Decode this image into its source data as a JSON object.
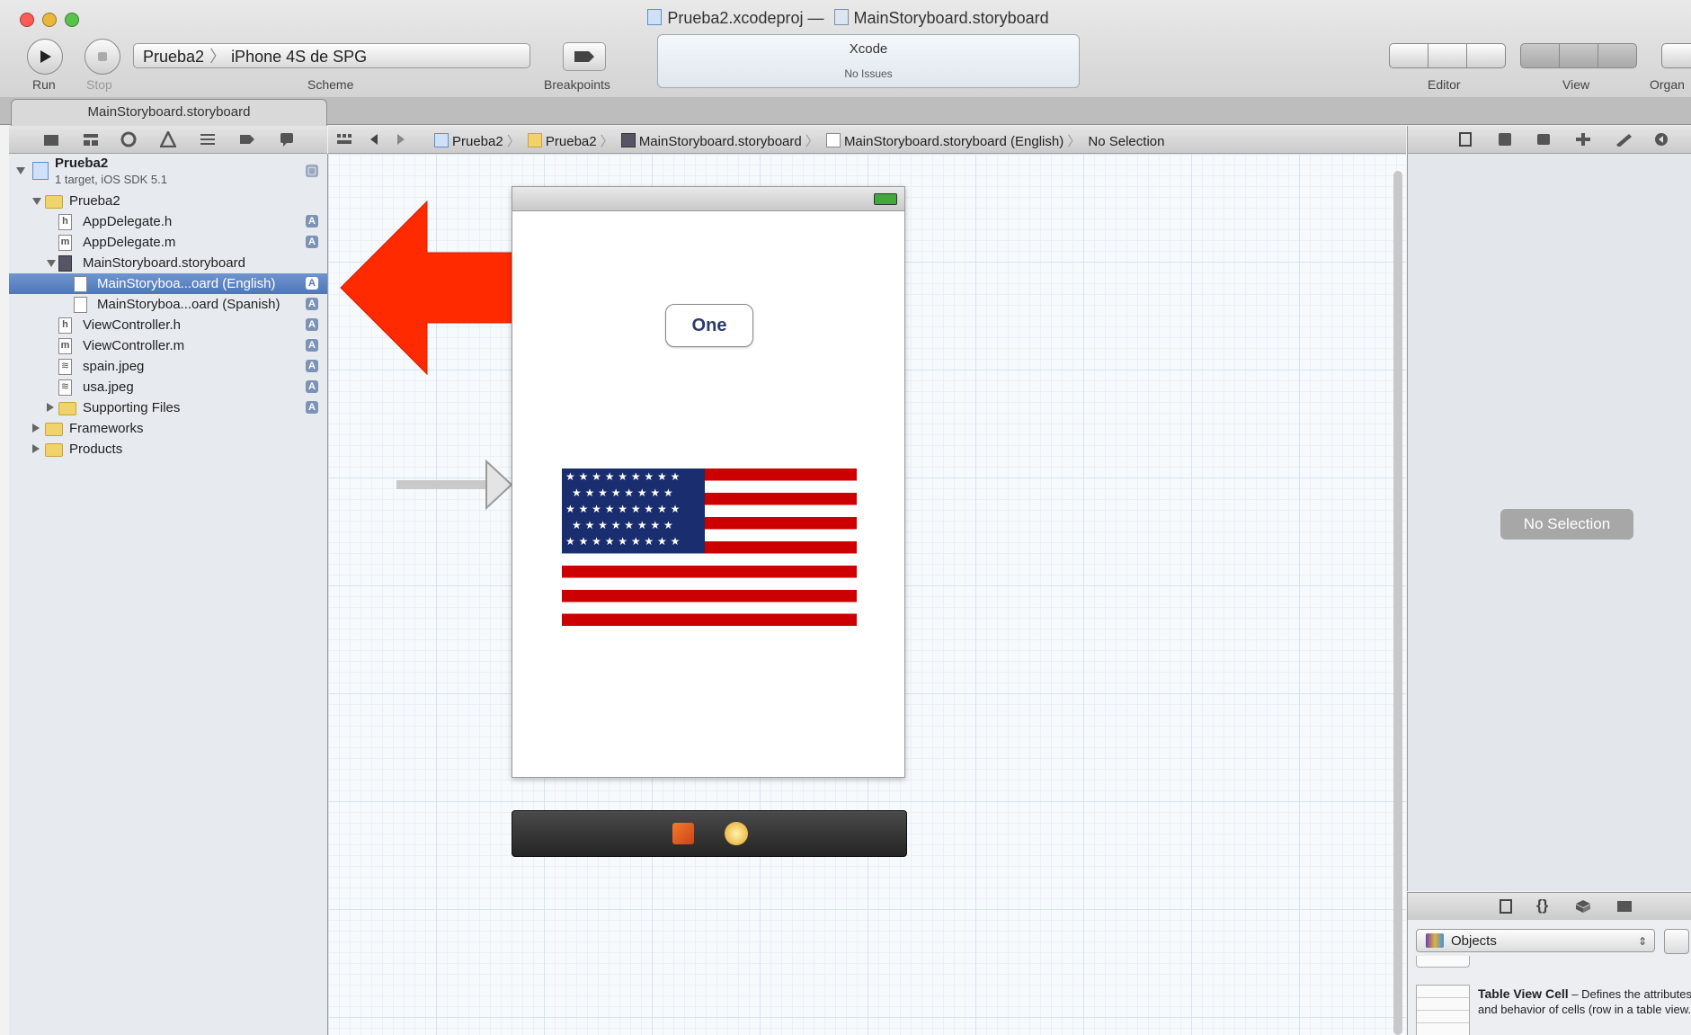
{
  "window": {
    "title_project": "Prueba2.xcodeproj",
    "title_separator": "—",
    "title_file": "MainStoryboard.storyboard"
  },
  "toolbar": {
    "run_label": "Run",
    "stop_label": "Stop",
    "scheme_label": "Scheme",
    "scheme_target": "Prueba2",
    "scheme_device": "iPhone 4S de SPG",
    "breakpoints_label": "Breakpoints",
    "activity_app": "Xcode",
    "activity_status": "No Issues",
    "editor_label": "Editor",
    "view_label": "View",
    "organizer_label": "Organ"
  },
  "tab": {
    "label": "MainStoryboard.storyboard"
  },
  "navigator": {
    "project_name": "Prueba2",
    "project_sub": "1 target, iOS SDK 5.1",
    "items": [
      {
        "label": "Prueba2",
        "kind": "folder",
        "badge": ""
      },
      {
        "label": "AppDelegate.h",
        "kind": "h",
        "badge": "A"
      },
      {
        "label": "AppDelegate.m",
        "kind": "m",
        "badge": "A"
      },
      {
        "label": "MainStoryboard.storyboard",
        "kind": "storyboard",
        "badge": ""
      },
      {
        "label": "MainStoryboa...oard (English)",
        "kind": "localized",
        "badge": "A"
      },
      {
        "label": "MainStoryboa...oard (Spanish)",
        "kind": "localized",
        "badge": "A"
      },
      {
        "label": "ViewController.h",
        "kind": "h",
        "badge": "A"
      },
      {
        "label": "ViewController.m",
        "kind": "m",
        "badge": "A"
      },
      {
        "label": "spain.jpeg",
        "kind": "image",
        "badge": "A"
      },
      {
        "label": "usa.jpeg",
        "kind": "image",
        "badge": "A"
      },
      {
        "label": "Supporting Files",
        "kind": "folder",
        "badge": "A"
      },
      {
        "label": "Frameworks",
        "kind": "folder",
        "badge": ""
      },
      {
        "label": "Products",
        "kind": "folder",
        "badge": ""
      }
    ],
    "file_glyph_h": "h",
    "file_glyph_m": "m",
    "file_glyph_image": "≋",
    "project_badge": "▢"
  },
  "jumpbar": {
    "crumbs": [
      "Prueba2",
      "Prueba2",
      "MainStoryboard.storyboard",
      "MainStoryboard.storyboard (English)",
      "No Selection"
    ]
  },
  "canvas": {
    "button_label": "One",
    "flag_image": "usa-flag"
  },
  "inspector": {
    "no_selection": "No Selection",
    "library_selector": "Objects",
    "library_item_title": "Table View Cell",
    "library_item_desc": " – Defines the attributes and behavior of cells (row in a table view."
  },
  "annotation": {
    "color": "#ff2a00",
    "meaning": "points-to-selected-file"
  },
  "colors": {
    "selection": "#5b82c0",
    "grid": "#d6e3f2"
  }
}
